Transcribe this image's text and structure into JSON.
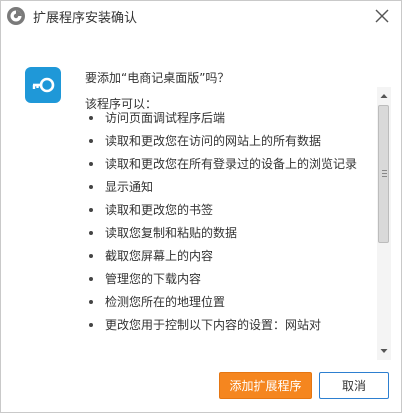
{
  "titlebar": {
    "title": "扩展程序安装确认",
    "app_icon": "browser-logo-icon",
    "close_icon": "close-icon"
  },
  "extension": {
    "icon": "key-icon",
    "icon_color": "#1f98d8",
    "question": "要添加“电商记桌面版”吗？",
    "permissions_heading": "该程序可以："
  },
  "permissions": [
    "访问页面调试程序后端",
    "读取和更改您在访问的网站上的所有数据",
    "读取和更改您在所有登录过的设备上的浏览记录",
    "显示通知",
    "读取和更改您的书签",
    "读取您复制和粘贴的数据",
    "截取您屏幕上的内容",
    "管理您的下载内容",
    "检测您所在的地理位置",
    "更改您用于控制以下内容的设置：网站对"
  ],
  "buttons": {
    "add_label": "添加扩展程序",
    "cancel_label": "取消"
  },
  "colors": {
    "primary": "#f5861f",
    "focus_border": "#2d7fd0"
  }
}
